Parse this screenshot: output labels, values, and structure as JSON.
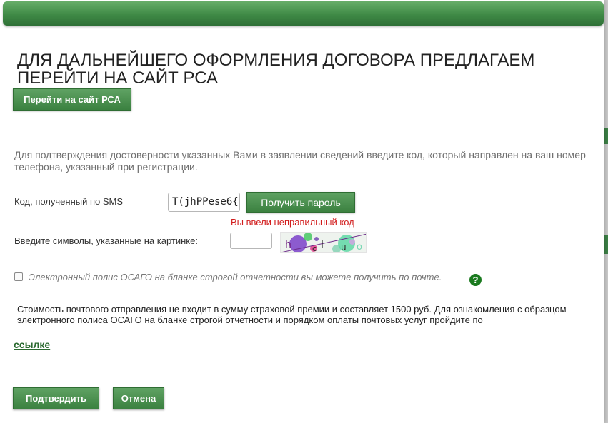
{
  "modal": {
    "heading": "ДЛЯ ДАЛЬНЕЙШЕГО ОФОРМЛЕНИЯ ДОГОВОРА ПРЕДЛАГАЕМ ПЕРЕЙТИ НА САЙТ РСА",
    "go_to_rsa_button": "Перейти на сайт РСА",
    "info_text": "Для подтверждения достоверности указанных Вами в заявлении сведений введите код, который направлен на ваш номер телефона, указанный при регистрации.",
    "sms": {
      "label": "Код, полученный по SMS",
      "value": "T(jhPPese6{",
      "get_password_button": "Получить пароль",
      "error": "Вы ввели неправильный код"
    },
    "captcha": {
      "label": "Введите символы, указанные на картинке:",
      "input_value": ""
    },
    "postal_option": {
      "checked": false,
      "label": "Электронный полис ОСАГО на бланке строгой отчетности вы можете получить по почте.",
      "help_icon": "question-circle-icon",
      "help_glyph": "?"
    },
    "cost_text": "Стоимость почтового отправления не входит в сумму страховой премии и составляет 1500 руб. Для ознакомления с образцом электронного полиса ОСАГО на бланке строгой отчетности и порядком оплаты почтовых услуг пройдите по",
    "link_text": "ссылке",
    "confirm_button": "Подтвердить",
    "cancel_button": "Отмена"
  },
  "colors": {
    "accent_green": "#3b8140",
    "error_red": "#d11d1d",
    "link_green": "#2b6a30"
  }
}
